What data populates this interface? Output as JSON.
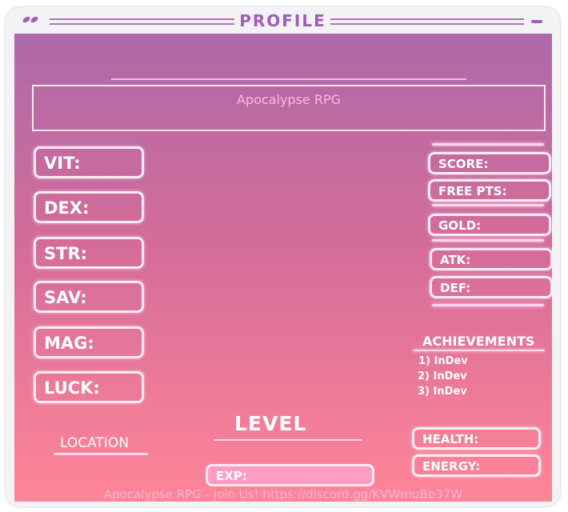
{
  "window": {
    "title": "PROFILE"
  },
  "header": {
    "game_name": "Apocalypse RPG"
  },
  "stats": [
    {
      "label": "VIT:"
    },
    {
      "label": "DEX:"
    },
    {
      "label": "STR:"
    },
    {
      "label": "SAV:"
    },
    {
      "label": "MAG:"
    },
    {
      "label": "LUCK:"
    }
  ],
  "side_stats": [
    {
      "label": "SCORE:"
    },
    {
      "label": "FREE PTS:"
    },
    {
      "label": "GOLD:"
    },
    {
      "label": "ATK:"
    },
    {
      "label": "DEF:"
    }
  ],
  "achievements": {
    "title": "ACHIEVEMENTS",
    "items": [
      "1) InDev",
      "2) InDev",
      "3) InDev"
    ]
  },
  "level_label": "LEVEL",
  "location_label": "LOCATION",
  "exp_label": "EXP:",
  "health_label": "HEALTH:",
  "energy_label": "ENERGY:",
  "footer": "Apocalypse RPG - Join Us! https://discord.gg/KVWmuBb37W",
  "colors": {
    "accent": "#a25db6",
    "gradient_top": "#ad6aa8",
    "gradient_bottom": "#ff8597",
    "box_border": "#fdebf4"
  }
}
